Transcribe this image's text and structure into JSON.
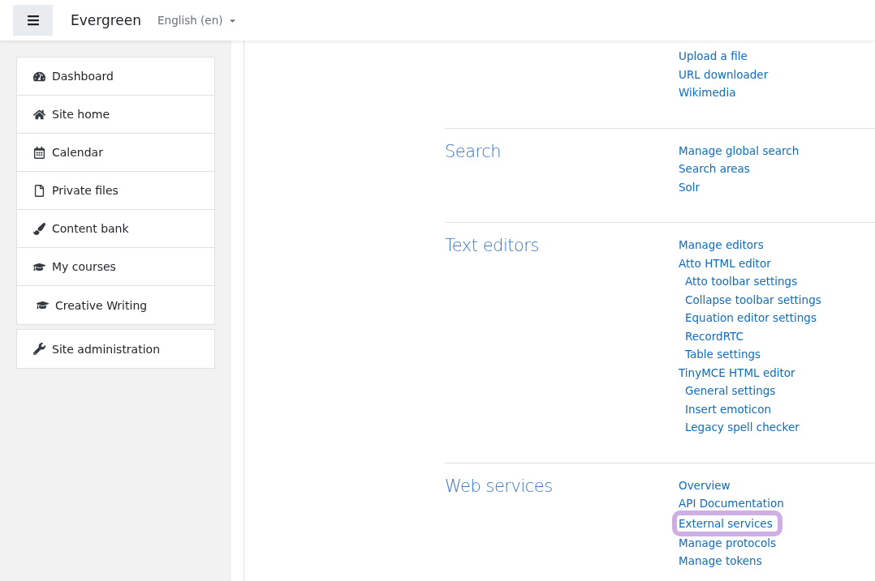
{
  "header": {
    "site_name": "Evergreen",
    "language": "English (en)"
  },
  "sidebar": {
    "groups": [
      {
        "items": [
          {
            "label": "Dashboard"
          },
          {
            "label": "Site home"
          },
          {
            "label": "Calendar"
          },
          {
            "label": "Private files"
          },
          {
            "label": "Content bank"
          },
          {
            "label": "My courses",
            "children": [
              {
                "label": "Creative Writing"
              }
            ]
          }
        ]
      },
      {
        "items": [
          {
            "label": "Site administration"
          }
        ]
      }
    ]
  },
  "sections": [
    {
      "links": [
        {
          "label": "Upload a file",
          "highlighted": false
        },
        {
          "label": "URL downloader",
          "highlighted": false
        },
        {
          "label": "Wikimedia",
          "highlighted": false
        }
      ]
    },
    {
      "heading": "Search",
      "links": [
        {
          "label": "Manage global search",
          "highlighted": false
        },
        {
          "label": "Search areas",
          "highlighted": false
        },
        {
          "label": "Solr",
          "highlighted": false
        }
      ]
    },
    {
      "heading": "Text editors",
      "links": [
        {
          "label": "Manage editors",
          "highlighted": false
        },
        {
          "label": "Atto HTML editor",
          "highlighted": false,
          "children": [
            {
              "label": "Atto toolbar settings",
              "highlighted": false
            },
            {
              "label": "Collapse toolbar settings",
              "highlighted": false
            },
            {
              "label": "Equation editor settings",
              "highlighted": false
            },
            {
              "label": "RecordRTC",
              "highlighted": false
            },
            {
              "label": "Table settings",
              "highlighted": false
            }
          ]
        },
        {
          "label": "TinyMCE HTML editor",
          "highlighted": false,
          "children": [
            {
              "label": "General settings",
              "highlighted": false
            },
            {
              "label": "Insert emoticon",
              "highlighted": false
            },
            {
              "label": "Legacy spell checker",
              "highlighted": false
            }
          ]
        }
      ]
    },
    {
      "heading": "Web services",
      "links": [
        {
          "label": "Overview",
          "highlighted": false
        },
        {
          "label": "API Documentation",
          "highlighted": false
        },
        {
          "label": "External services",
          "highlighted": true
        },
        {
          "label": "Manage protocols",
          "highlighted": false
        },
        {
          "label": "Manage tokens",
          "highlighted": false
        }
      ]
    }
  ]
}
